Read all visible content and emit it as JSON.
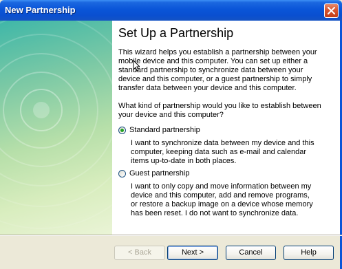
{
  "window": {
    "title": "New Partnership",
    "close_icon": "close-icon"
  },
  "page": {
    "title": "Set Up a Partnership",
    "intro": "This wizard helps you establish a partnership between your mobile device and this computer.  You can set up either a standard partnership to synchronize data between your device and this computer, or a guest partnership to simply transfer data between your device and this computer.",
    "question": "What kind of partnership would you like to establish between your device and this computer?"
  },
  "options": {
    "standard": {
      "label": "Standard partnership",
      "description": "I want to synchronize data between my device and this computer, keeping data such as e-mail and calendar items up-to-date in both places.",
      "selected": true
    },
    "guest": {
      "label": "Guest partnership",
      "description": "I want to only copy and move information between my device and this computer, add and remove programs, or restore a backup image on a device whose memory has been reset. I do not want to synchronize data.",
      "selected": false
    }
  },
  "buttons": {
    "back": "< Back",
    "next": "Next >",
    "cancel": "Cancel",
    "help": "Help"
  },
  "colors": {
    "titlebar": "#0a55d8",
    "radio_checked": "#21a121",
    "close_button": "#d8552f"
  }
}
